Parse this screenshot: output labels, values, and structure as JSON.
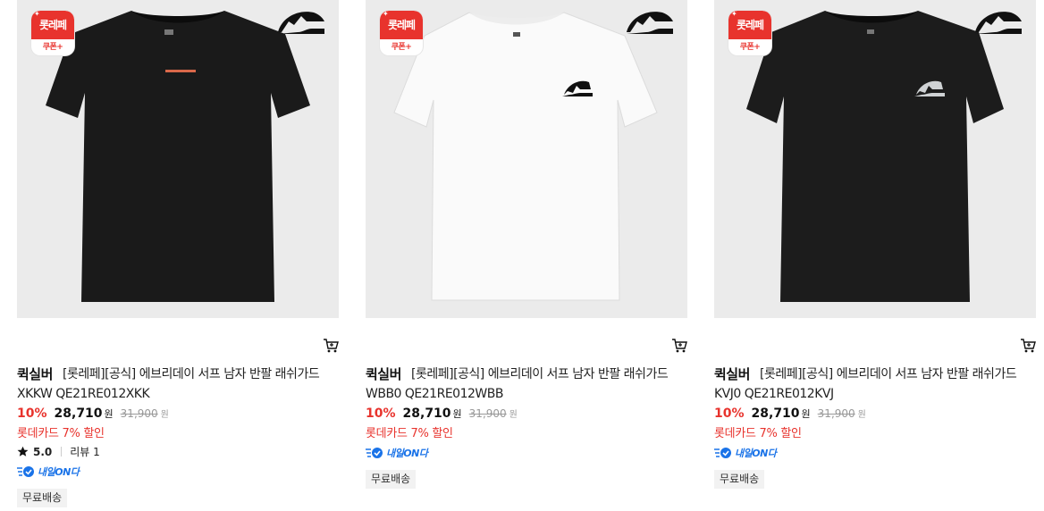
{
  "products": [
    {
      "coupon_top": "롯레페",
      "coupon_bottom": "쿠폰+",
      "brand": "퀵실버",
      "name": "[롯레페][공식] 에브리데이 서프 남자 반팔 래쉬가드 XKKW QE21RE012XKK",
      "discount": "10%",
      "price": "28,710",
      "won": "원",
      "original": "31,900",
      "original_won": "원",
      "card_discount": "롯데카드 7% 할인",
      "rating": "5.0",
      "reviews": "리뷰 1",
      "delivery_badge": "내일ON다",
      "shipping": "무료배송",
      "shirt_color": "#1a1a1a"
    },
    {
      "coupon_top": "롯레페",
      "coupon_bottom": "쿠폰+",
      "brand": "퀵실버",
      "name": "[롯레페][공식] 에브리데이 서프 남자 반팔 래쉬가드 WBB0 QE21RE012WBB",
      "discount": "10%",
      "price": "28,710",
      "won": "원",
      "original": "31,900",
      "original_won": "원",
      "card_discount": "롯데카드 7% 할인",
      "delivery_badge": "내일ON다",
      "shipping": "무료배송",
      "shirt_color": "#fafafa"
    },
    {
      "coupon_top": "롯레페",
      "coupon_bottom": "쿠폰+",
      "brand": "퀵실버",
      "name": "[롯레페][공식] 에브리데이 서프 남자 반팔 래쉬가드 KVJ0 QE21RE012KVJ",
      "discount": "10%",
      "price": "28,710",
      "won": "원",
      "original": "31,900",
      "original_won": "원",
      "card_discount": "롯데카드 7% 할인",
      "delivery_badge": "내일ON다",
      "shipping": "무료배송",
      "shirt_color": "#1c1c1c"
    }
  ],
  "colors": {
    "accent_red": "#e8332d",
    "delivery_blue": "#1a73e8",
    "thumb_bg": "#ebebeb"
  }
}
